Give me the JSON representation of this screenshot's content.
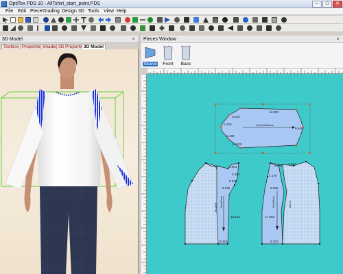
{
  "window": {
    "title": "OptiTex PDS 10 - AllTshirt_start_point.PDS",
    "min_label": "–",
    "max_label": "□",
    "close_label": "✕"
  },
  "menu": [
    "File",
    "Edit",
    "Piece",
    "Grading",
    "Design",
    "3D",
    "Tools",
    "View",
    "Help"
  ],
  "panes": {
    "model_title": "3D Model",
    "pieces_title": "Pieces Window",
    "close_glyph": "×"
  },
  "tabs_3d": [
    {
      "label": "Toolbox",
      "active": false
    },
    {
      "label": "Properties",
      "active": false
    },
    {
      "label": "Shader",
      "active": false
    },
    {
      "label": "3D Properties",
      "active": false
    },
    {
      "label": "3D Model",
      "active": true
    }
  ],
  "piece_thumbs": [
    {
      "label": "Sleeve",
      "selected": true
    },
    {
      "label": "Front",
      "selected": false
    },
    {
      "label": "Back",
      "selected": false
    }
  ],
  "sleeve_piece": {
    "name": "Trimshirt/Sleeve",
    "seam_labels": [
      "13.000",
      "9.548",
      "0.320",
      "0.435",
      "4.435",
      "14.528"
    ]
  },
  "front_piece": {
    "name": "Tshirt/Front",
    "seam_labels": [
      "1.651",
      "5.452",
      "0.625",
      "5.025",
      "20.478",
      "16.151",
      "9.315"
    ]
  },
  "back_piece": {
    "name": "Tshirt/Back",
    "seam_labels": [
      "4.250",
      "2.251",
      "4.175",
      "5.025",
      "23.11",
      "17.552",
      "9.302"
    ]
  },
  "colors": {
    "canvas_bg": "#3ec9cb",
    "piece_fill": "#a9c8f4",
    "grid_fill": "#c9ddf4",
    "shirt_white": "#ffffff",
    "stitch_blue": "#1d35d6",
    "bbox_green": "#5ad13a",
    "jeans": "#2c3550"
  }
}
